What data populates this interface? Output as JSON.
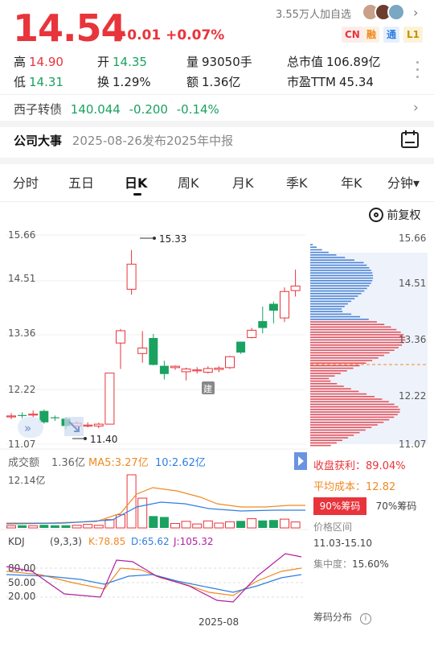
{
  "quote": {
    "price": "14.54",
    "change": "+0.01 +0.07%",
    "watchers": "3.55万人加自选",
    "tags": [
      "CN",
      "融",
      "通",
      "L1"
    ]
  },
  "stats": {
    "high_label": "高",
    "high": "14.90",
    "open_label": "开",
    "open": "14.35",
    "volume_label": "量",
    "volume": "93050手",
    "mcap_label": "总市值",
    "mcap": "106.89亿",
    "low_label": "低",
    "low": "14.31",
    "turnover_label": "换",
    "turnover": "1.29%",
    "amount_label": "额",
    "amount": "1.36亿",
    "pe_label": "市盈TTM",
    "pe": "45.34"
  },
  "bond": {
    "name": "西子转债",
    "price": "140.044",
    "change": "-0.200",
    "pct": "-0.14%"
  },
  "event": {
    "title": "公司大事",
    "text": "2025-08-26发布2025年中报"
  },
  "tabs": [
    "分时",
    "五日",
    "日K",
    "周K",
    "月K",
    "季K",
    "年K",
    "分钟▾"
  ],
  "adjust_label": "前复权",
  "price_axis": [
    "15.66",
    "14.51",
    "13.36",
    "12.22",
    "11.07"
  ],
  "annotations": {
    "high": "15.33",
    "low": "11.40",
    "marker": "建"
  },
  "volume": {
    "label": "成交额",
    "value": "1.36亿",
    "ma5": "MA5:3.27亿",
    "ma10": "10:2.62亿",
    "axis_max": "12.14亿"
  },
  "kdj": {
    "label": "KDJ",
    "params": "(9,3,3)",
    "k": "K:78.85",
    "d": "D:65.62",
    "j": "J:105.32",
    "axis": [
      "80.00",
      "50.00",
      "20.00"
    ]
  },
  "x_label": "2025-08",
  "chips": {
    "profit_label": "收盘获利：",
    "profit": "89.04%",
    "cost_label": "平均成本：",
    "cost": "12.82",
    "tab90": "90%筹码",
    "tab70": "70%筹码",
    "range_label": "价格区间",
    "range": "11.03-15.10",
    "concentration_label": "集中度：",
    "concentration": "15.60%",
    "dist_label": "筹码分布"
  },
  "chart_data": {
    "type": "candlestick",
    "candles": [
      {
        "o": 11.69,
        "c": 11.69,
        "h": 11.75,
        "l": 11.62
      },
      {
        "o": 11.71,
        "c": 11.7,
        "h": 11.77,
        "l": 11.64
      },
      {
        "o": 11.72,
        "c": 11.73,
        "h": 11.81,
        "l": 11.66
      },
      {
        "o": 11.8,
        "c": 11.55,
        "h": 11.83,
        "l": 11.52
      },
      {
        "o": 11.66,
        "c": 11.64,
        "h": 11.7,
        "l": 11.58
      },
      {
        "o": 11.63,
        "c": 11.47,
        "h": 11.65,
        "l": 11.4
      },
      {
        "o": 11.47,
        "c": 11.53,
        "h": 11.57,
        "l": 11.45
      },
      {
        "o": 11.47,
        "c": 11.49,
        "h": 11.55,
        "l": 11.44
      },
      {
        "o": 11.47,
        "c": 11.51,
        "h": 11.54,
        "l": 11.42
      },
      {
        "o": 11.51,
        "c": 12.63,
        "h": 12.63,
        "l": 11.51
      },
      {
        "o": 13.29,
        "c": 13.56,
        "h": 13.6,
        "l": 12.72
      },
      {
        "o": 14.47,
        "c": 15.02,
        "h": 15.33,
        "l": 14.35
      },
      {
        "o": 13.06,
        "c": 13.18,
        "h": 13.55,
        "l": 12.86
      },
      {
        "o": 13.4,
        "c": 12.81,
        "h": 13.49,
        "l": 12.8
      },
      {
        "o": 12.79,
        "c": 12.61,
        "h": 12.9,
        "l": 12.49
      },
      {
        "o": 12.75,
        "c": 12.78,
        "h": 12.8,
        "l": 12.7
      },
      {
        "o": 12.66,
        "c": 12.72,
        "h": 12.75,
        "l": 12.47
      },
      {
        "o": 12.69,
        "c": 12.7,
        "h": 12.76,
        "l": 12.62
      },
      {
        "o": 12.65,
        "c": 12.73,
        "h": 12.78,
        "l": 12.62
      },
      {
        "o": 12.71,
        "c": 12.74,
        "h": 12.78,
        "l": 12.65
      },
      {
        "o": 12.75,
        "c": 12.99,
        "h": 13.01,
        "l": 12.72
      },
      {
        "o": 13.32,
        "c": 13.08,
        "h": 13.32,
        "l": 13.05
      },
      {
        "o": 13.41,
        "c": 13.57,
        "h": 13.62,
        "l": 13.39
      },
      {
        "o": 13.77,
        "c": 13.62,
        "h": 14.09,
        "l": 13.5
      },
      {
        "o": 14.15,
        "c": 14.0,
        "h": 14.2,
        "l": 13.72
      },
      {
        "o": 13.84,
        "c": 14.42,
        "h": 14.51,
        "l": 13.75
      },
      {
        "o": 14.44,
        "c": 14.54,
        "h": 14.9,
        "l": 14.31
      }
    ],
    "volume_values": [
      0.5,
      0.6,
      0.5,
      0.7,
      0.6,
      0.6,
      0.6,
      0.8,
      0.6,
      1.9,
      3.0,
      12.14,
      6.8,
      2.7,
      2.5,
      1.0,
      1.5,
      0.9,
      1.6,
      1.1,
      1.4,
      1.6,
      2.1,
      1.7,
      1.8,
      2.0,
      1.36
    ],
    "ylim": [
      11.07,
      15.66
    ]
  }
}
